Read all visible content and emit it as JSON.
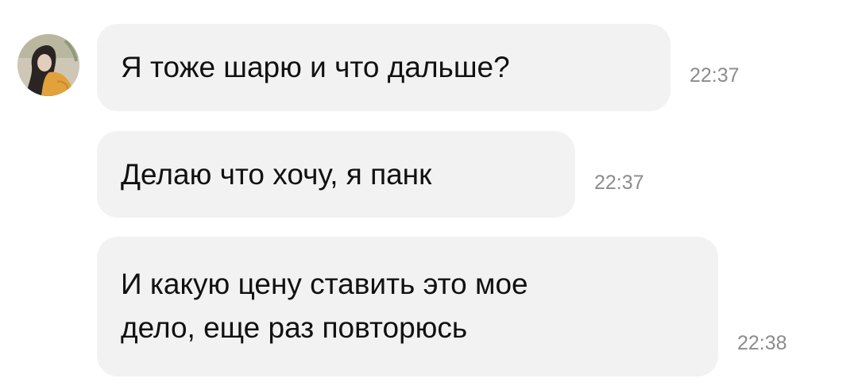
{
  "sender": {
    "avatar_icon": "user-photo-avatar"
  },
  "messages": [
    {
      "text": "Я тоже шарю и что дальше?",
      "time": "22:37"
    },
    {
      "text": "Делаю что хочу, я панк",
      "time": "22:37"
    },
    {
      "text": "И какую цену ставить это мое\nдело, еще раз повторюсь",
      "time": "22:38"
    }
  ],
  "colors": {
    "bubble_background": "#f2f2f2",
    "message_text": "#111111",
    "timestamp_text": "#8c8c8c",
    "background": "#ffffff"
  }
}
